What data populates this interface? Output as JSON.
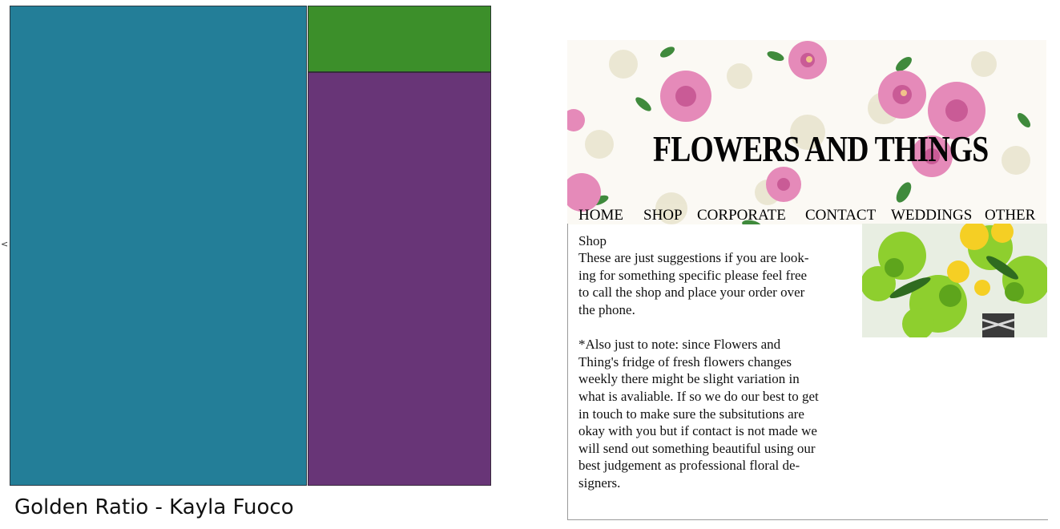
{
  "caption": "Golden Ratio - Kayla Fuoco",
  "caret": "<",
  "swatch_colors": {
    "teal": "#237e98",
    "green": "#3c8f2a",
    "purple": "#683577"
  },
  "site": {
    "title": "FLOWERS AND THINGS",
    "nav": [
      "HOME",
      "SHOP",
      "CORPORATE",
      "CONTACT",
      "WEDDINGS",
      "OTHER"
    ],
    "section_title": "Shop",
    "paragraph1": [
      "These are just suggestions if you are look-",
      "ing for something specific please feel free",
      "to call the shop and place your order over",
      "the phone."
    ],
    "paragraph2": [
      "*Also just to note: since Flowers and",
      "Thing's fridge of fresh flowers changes",
      "weekly there might be slight variation in",
      "what is avaliable. If so we do our best to get",
      "in touch to make sure the subsitutions are",
      "okay with you but if contact is not made we",
      "will send out something beautiful using our",
      "best judgement as professional floral de-",
      "signers."
    ]
  }
}
